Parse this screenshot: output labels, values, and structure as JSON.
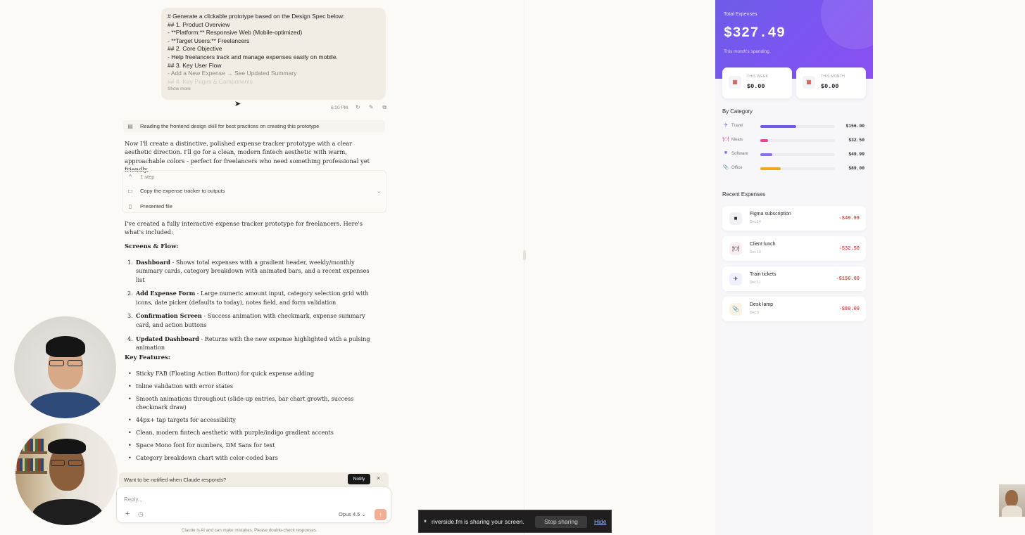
{
  "chat": {
    "user_message_lines": [
      "# Generate a clickable prototype based on the Design Spec below:",
      "## 1. Product Overview",
      "- **Platform:** Responsive Web (Mobile-optimized)",
      "- **Target Users:** Freelancers",
      "## 2. Core Objective",
      "- Help freelancers track and manage expenses easily on mobile.",
      "## 3. Key User Flow",
      "- Add a New Expense → See Updated Summary",
      "## 4. Key Pages & Components"
    ],
    "show_more": "Show more",
    "timestamp": "6:20 PM",
    "tool_reading": "Reading the frontend design skill for best practices on creating this prototype",
    "intro": "Now I'll create a distinctive, polished expense tracker prototype with a clear aesthetic direction. I'll go for a clean, modern fintech aesthetic with warm, approachable colors - perfect for freelancers who need something professional yet friendly.",
    "step_count": "1 step",
    "tool_copy": "Copy the expense tracker to outputs",
    "tool_presented": "Presented file",
    "summary": "I've created a fully interactive expense tracker prototype for freelancers. Here's what's included:",
    "screens_heading": "Screens & Flow:",
    "screens": [
      {
        "title": "Dashboard",
        "desc": " - Shows total expenses with a gradient header, weekly/monthly summary cards, category breakdown with animated bars, and a recent expenses list"
      },
      {
        "title": "Add Expense Form",
        "desc": " - Large numeric amount input, category selection grid with icons, date picker (defaults to today), notes field, and form validation"
      },
      {
        "title": "Confirmation Screen",
        "desc": " - Success animation with checkmark, expense summary card, and action buttons"
      },
      {
        "title": "Updated Dashboard",
        "desc": " - Returns with the new expense highlighted with a pulsing animation"
      }
    ],
    "features_heading": "Key Features:",
    "features": [
      "Sticky FAB (Floating Action Button) for quick expense adding",
      "Inline validation with error states",
      "Smooth animations throughout (slide-up entries, bar chart growth, success checkmark draw)",
      "44px+ tap targets for accessibility",
      "Clean, modern fintech aesthetic with purple/indigo gradient accents",
      "Space Mono font for numbers, DM Sans for text",
      "Category breakdown chart with color-coded bars"
    ],
    "notify_text": "Want to be notified when Claude responds?",
    "notify_button": "Notify",
    "reply_placeholder": "Reply...",
    "model": "Opus 4.5",
    "disclaimer": "Claude is AI and can make mistakes. Please double-check responses."
  },
  "prototype": {
    "total_label": "Total Expenses",
    "total_amount": "$327.49",
    "total_sub": "This month's spending",
    "week_label": "THIS WEEK",
    "week_value": "$0.00",
    "month_label": "THIS MONTH",
    "month_value": "$0.00",
    "category_heading": "By Category",
    "categories": [
      {
        "name": "Travel",
        "amount": "$156.00",
        "icon": "airplane-icon",
        "color": "#6c5ce7",
        "fraction": 0.48
      },
      {
        "name": "Meals",
        "amount": "$32.50",
        "icon": "meal-icon",
        "color": "#e84393",
        "fraction": 0.1
      },
      {
        "name": "Software",
        "amount": "$49.99",
        "icon": "laptop-icon",
        "color": "#8e6cf0",
        "fraction": 0.16
      },
      {
        "name": "Office",
        "amount": "$89.00",
        "icon": "paperclip-icon",
        "color": "#f0a818",
        "fraction": 0.27
      }
    ],
    "recent_heading": "Recent Expenses",
    "expenses": [
      {
        "name": "Figma subscription",
        "date": "Dec 14",
        "amount": "-$49.99",
        "icon": "laptop-icon"
      },
      {
        "name": "Client lunch",
        "date": "Dec 13",
        "amount": "-$32.50",
        "icon": "meal-icon"
      },
      {
        "name": "Train tickets",
        "date": "Dec 11",
        "amount": "-$156.00",
        "icon": "airplane-icon"
      },
      {
        "name": "Desk lamp",
        "date": "Dec 9",
        "amount": "-$89.00",
        "icon": "paperclip-icon"
      }
    ]
  },
  "share_bar": {
    "text": "riverside.fm is sharing your screen.",
    "stop": "Stop sharing",
    "hide": "Hide"
  },
  "colors": {
    "accent_purple": "#6d5ce8",
    "negative": "#e5534b",
    "send_button": "#f2ad95"
  }
}
